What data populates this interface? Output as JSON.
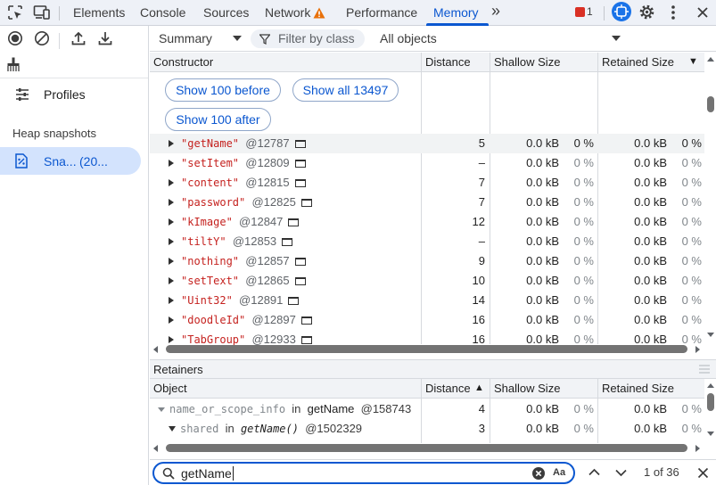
{
  "tabs": [
    {
      "label": "Elements",
      "active": false
    },
    {
      "label": "Console",
      "active": false
    },
    {
      "label": "Sources",
      "active": false
    },
    {
      "label": "Network",
      "active": false,
      "warning": true
    },
    {
      "label": "Performance",
      "active": false
    },
    {
      "label": "Memory",
      "active": true
    }
  ],
  "tabs_more": "»",
  "issues_count": "1",
  "colors": {
    "accent": "#0b57d0",
    "warning": "#e8710a",
    "error": "#d93025",
    "selection": "#d3e3fd"
  },
  "sidebar": {
    "profiles_label": "Profiles",
    "heap_snapshots_label": "Heap snapshots",
    "snapshot_name": "Sna...",
    "snapshot_size": "(20..."
  },
  "toolbar": {
    "view": "Summary",
    "filter_placeholder": "Filter by class",
    "scope": "All objects"
  },
  "constructor_table": {
    "headers": {
      "constructor": "Constructor",
      "distance": "Distance",
      "shallow": "Shallow Size",
      "retained": "Retained Size",
      "sort": "▼"
    },
    "buttons": {
      "before": "Show 100 before",
      "all": "Show all 13497",
      "after": "Show 100 after"
    },
    "rows": [
      {
        "name": "\"getName\"",
        "id": "@12787",
        "distance": "5",
        "shallow": "0.0 kB",
        "shallow_pct": "0 %",
        "retained": "0.0 kB",
        "retained_pct": "0 %",
        "selected": true
      },
      {
        "name": "\"setItem\"",
        "id": "@12809",
        "distance": "–",
        "shallow": "0.0 kB",
        "shallow_pct": "0 %",
        "retained": "0.0 kB",
        "retained_pct": "0 %"
      },
      {
        "name": "\"content\"",
        "id": "@12815",
        "distance": "7",
        "shallow": "0.0 kB",
        "shallow_pct": "0 %",
        "retained": "0.0 kB",
        "retained_pct": "0 %"
      },
      {
        "name": "\"password\"",
        "id": "@12825",
        "distance": "7",
        "shallow": "0.0 kB",
        "shallow_pct": "0 %",
        "retained": "0.0 kB",
        "retained_pct": "0 %"
      },
      {
        "name": "\"kImage\"",
        "id": "@12847",
        "distance": "12",
        "shallow": "0.0 kB",
        "shallow_pct": "0 %",
        "retained": "0.0 kB",
        "retained_pct": "0 %"
      },
      {
        "name": "\"tiltY\"",
        "id": "@12853",
        "distance": "–",
        "shallow": "0.0 kB",
        "shallow_pct": "0 %",
        "retained": "0.0 kB",
        "retained_pct": "0 %"
      },
      {
        "name": "\"nothing\"",
        "id": "@12857",
        "distance": "9",
        "shallow": "0.0 kB",
        "shallow_pct": "0 %",
        "retained": "0.0 kB",
        "retained_pct": "0 %"
      },
      {
        "name": "\"setText\"",
        "id": "@12865",
        "distance": "10",
        "shallow": "0.0 kB",
        "shallow_pct": "0 %",
        "retained": "0.0 kB",
        "retained_pct": "0 %"
      },
      {
        "name": "\"Uint32\"",
        "id": "@12891",
        "distance": "14",
        "shallow": "0.0 kB",
        "shallow_pct": "0 %",
        "retained": "0.0 kB",
        "retained_pct": "0 %"
      },
      {
        "name": "\"doodleId\"",
        "id": "@12897",
        "distance": "16",
        "shallow": "0.0 kB",
        "shallow_pct": "0 %",
        "retained": "0.0 kB",
        "retained_pct": "0 %"
      },
      {
        "name": "\"TabGroup\"",
        "id": "@12933",
        "distance": "16",
        "shallow": "0.0 kB",
        "shallow_pct": "0 %",
        "retained": "0.0 kB",
        "retained_pct": "0 %"
      }
    ]
  },
  "retainers": {
    "title": "Retainers",
    "headers": {
      "object": "Object",
      "distance": "Distance",
      "sort": "▲",
      "shallow": "Shallow Size",
      "retained": "Retained Size"
    },
    "rows": [
      {
        "prop": "name_or_scope_info",
        "in": "in",
        "target": "getName",
        "id": "@158743",
        "distance": "4",
        "shallow": "0.0 kB",
        "shallow_pct": "0 %",
        "retained": "0.0 kB",
        "retained_pct": "0 %"
      },
      {
        "prop": "shared",
        "in": "in",
        "target": "getName()",
        "id": "@1502329",
        "distance": "3",
        "shallow": "0.0 kB",
        "shallow_pct": "0 %",
        "retained": "0.0 kB",
        "retained_pct": "0 %"
      }
    ]
  },
  "search": {
    "value": "getName",
    "case_label": "Aa",
    "result_count": "1 of 36"
  }
}
